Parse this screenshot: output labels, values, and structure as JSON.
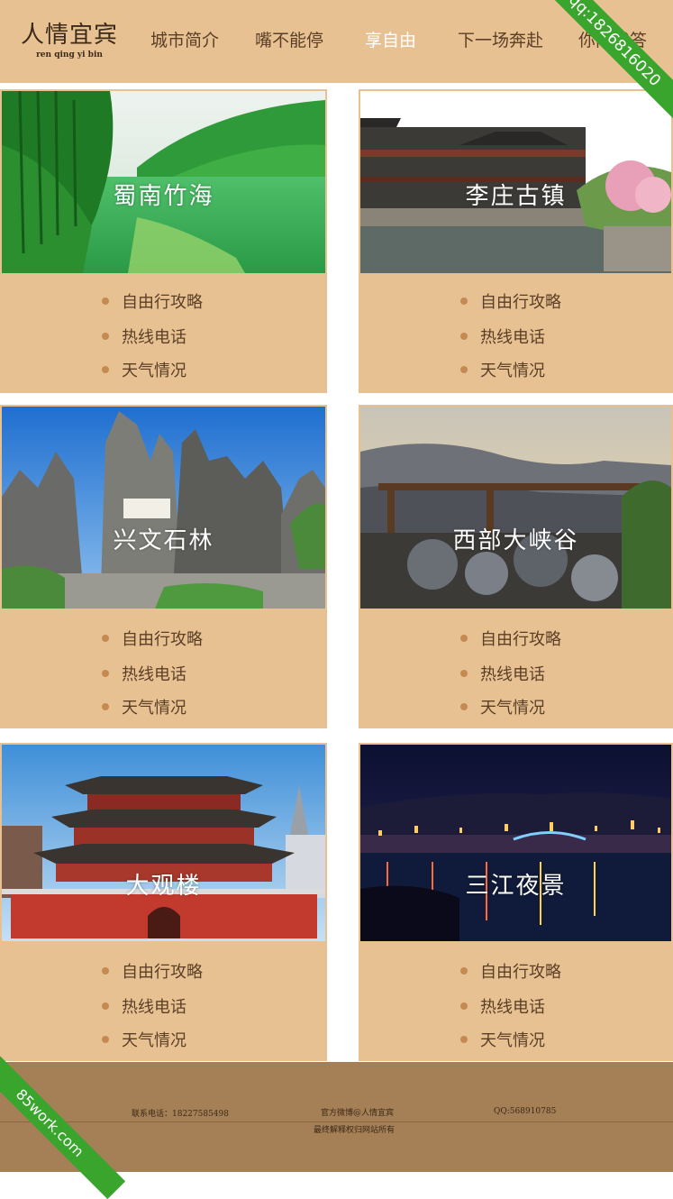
{
  "header": {
    "logo_title": "人情宜宾",
    "logo_subtitle": "ren qing yi bin",
    "nav": [
      "城市简介",
      "嘴不能停",
      "享自由",
      "下一场奔赴",
      "你问我答"
    ],
    "active_index": 2
  },
  "watermark_top": "qq:1826816020",
  "watermark_bottom": "85work.com",
  "cards": [
    {
      "name": "蜀南竹海",
      "links": [
        "自由行攻略",
        "热线电话",
        "天气情况"
      ]
    },
    {
      "name": "李庄古镇",
      "links": [
        "自由行攻略",
        "热线电话",
        "天气情况"
      ]
    },
    {
      "name": "兴文石林",
      "links": [
        "自由行攻略",
        "热线电话",
        "天气情况"
      ]
    },
    {
      "name": "西部大峡谷",
      "links": [
        "自由行攻略",
        "热线电话",
        "天气情况"
      ]
    },
    {
      "name": "大观楼",
      "links": [
        "自由行攻略",
        "热线电话",
        "天气情况"
      ]
    },
    {
      "name": "三江夜景",
      "links": [
        "自由行攻略",
        "热线电话",
        "天气情况"
      ]
    }
  ],
  "footer": {
    "phone": "联系电话：18227585498",
    "weibo": "官方微博@人情宜宾",
    "qq": "QQ:568910785",
    "rights": "最终解释权归网站所有"
  },
  "colors": {
    "header_bg": "#e8c193",
    "footer_bg": "#a57f55",
    "bullet": "#c58a52",
    "watermark": "#3aa52c"
  }
}
